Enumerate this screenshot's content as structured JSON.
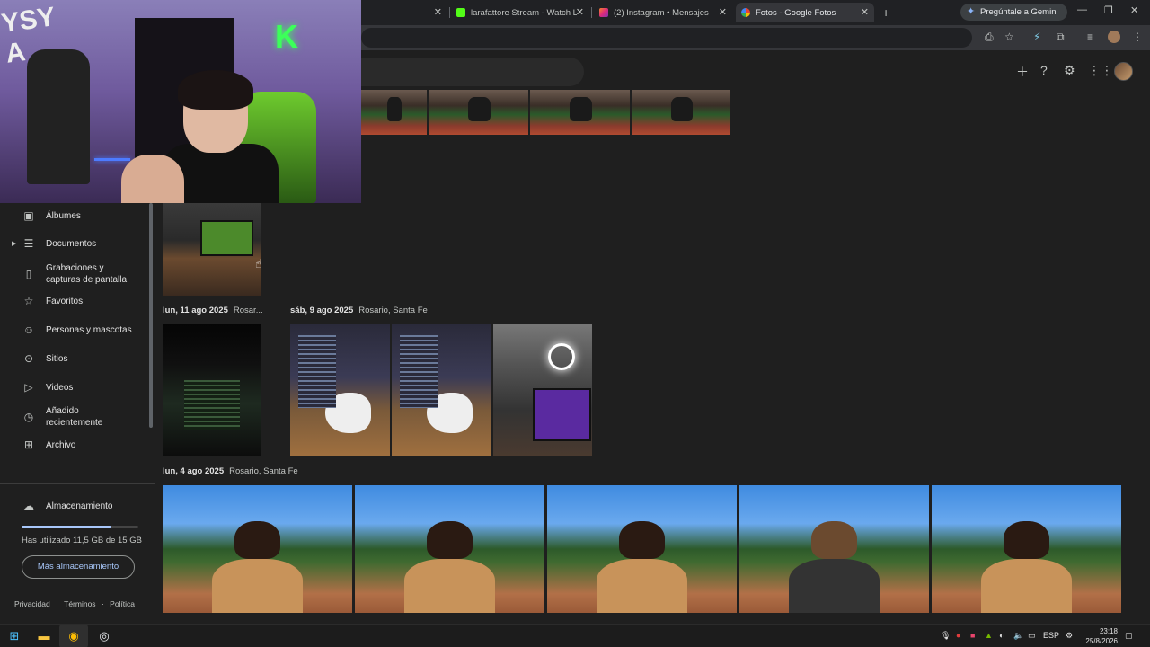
{
  "browser": {
    "tabs": [
      {
        "label": "",
        "active": false
      },
      {
        "label": "larafattore Stream - Watch Live",
        "active": false
      },
      {
        "label": "(2) Instagram • Mensajes",
        "active": false
      },
      {
        "label": "Fotos - Google Fotos",
        "active": true
      }
    ],
    "gemini_label": "Pregúntale a Gemini",
    "colors": {
      "tab_bar": "#202124",
      "toolbar": "#35363a",
      "kick_green": "#53fc18",
      "instagram": "#e1306c"
    }
  },
  "sidebar": {
    "items": [
      {
        "label": "Álbumes",
        "icon": "album-icon"
      },
      {
        "label": "Documentos",
        "icon": "document-icon"
      },
      {
        "label": "Grabaciones y capturas de pantalla",
        "line1": "Grabaciones y",
        "line2": "capturas de pantalla",
        "icon": "phone-screenshot-icon"
      },
      {
        "label": "Favoritos",
        "icon": "star-icon"
      },
      {
        "label": "Personas y mascotas",
        "icon": "face-icon"
      },
      {
        "label": "Sitios",
        "icon": "location-pin-icon"
      },
      {
        "label": "Videos",
        "icon": "play-circle-icon"
      },
      {
        "label": "Añadido recientemente",
        "line1": "Añadido",
        "line2": "recientemente",
        "icon": "clock-icon"
      },
      {
        "label": "Archivo",
        "icon": "archive-icon"
      }
    ],
    "storage": {
      "label": "Almacenamiento",
      "used_text": "Has utilizado 11,5 GB de 15 GB",
      "used_fraction": 0.767,
      "button": "Más almacenamiento"
    },
    "footer": {
      "privacy": "Privacidad",
      "terms": "Términos",
      "policy": "Política",
      "sep": "·"
    }
  },
  "main": {
    "groups": [
      {
        "date": "lun, 11 ago 2025",
        "location": "Rosar..."
      },
      {
        "date": "sáb, 9 ago 2025",
        "location": "Rosario, Santa Fe"
      },
      {
        "date": "lun, 4 ago 2025",
        "location": "Rosario, Santa Fe"
      }
    ]
  },
  "taskbar": {
    "language": "ESP",
    "time": "23:18",
    "date": "25/8/2026"
  }
}
